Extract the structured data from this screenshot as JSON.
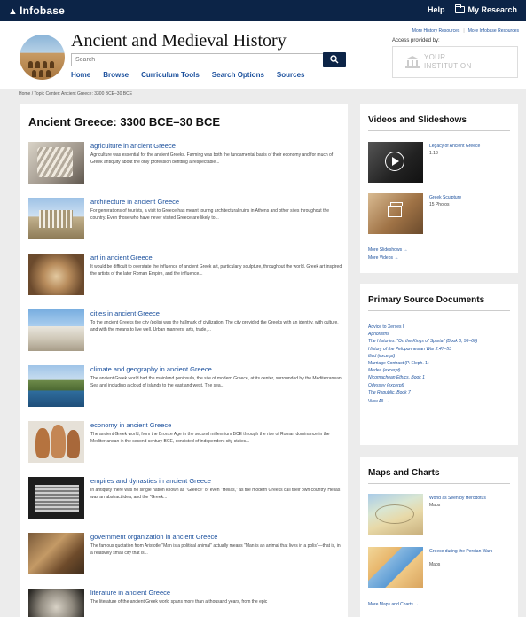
{
  "topbar": {
    "logo": "Infobase",
    "help": "Help",
    "my_research": "My Research"
  },
  "header": {
    "site_title": "Ancient and Medieval History",
    "search_placeholder": "Search",
    "nav": [
      "Home",
      "Browse",
      "Curriculum Tools",
      "Search Options",
      "Sources"
    ],
    "util_links": [
      "More History Resources",
      "More Infobase Resources"
    ],
    "access_label": "Access provided by:",
    "institution_line1": "YOUR",
    "institution_line2": "INSTITUTION"
  },
  "breadcrumb": "Home / Topic Center: Ancient Greece: 3300 BCE–30 BCE",
  "main": {
    "title": "Ancient Greece: 3300 BCE–30 BCE",
    "topics": [
      {
        "title": "agriculture in ancient Greece",
        "desc": "Agriculture was essential for the ancient Greeks. Farming was both the fundamental basis of their economy and for much of Greek antiquity about the only profession befitting a respectable..."
      },
      {
        "title": "architecture in ancient Greece",
        "desc": "For generations of tourists, a visit to Greece has meant touring architectural ruins in Athens and other sites throughout the country. Even those who have never visited Greece are likely to..."
      },
      {
        "title": "art in ancient Greece",
        "desc": "It would be difficult to overstate the influence of ancient Greek art, particularly sculpture, throughout the world. Greek art inspired the artists of the later Roman Empire, and the influence..."
      },
      {
        "title": "cities in ancient Greece",
        "desc": "To the ancient Greeks the city (polis) was the hallmark of civilization. The city provided the Greeks with an identity, with culture, and with the means to live well. Urban manners, arts, trade,..."
      },
      {
        "title": "climate and geography in ancient Greece",
        "desc": "The ancient Greek world had the mainland peninsula, the site of modern Greece, at its center, surrounded by the Mediterranean Sea and including a cloud of islands to the east and west. The sea..."
      },
      {
        "title": "economy in ancient Greece",
        "desc": "The ancient Greek world, from the Bronze Age in the second millennium BCE through the rise of Roman dominance in the Mediterranean in the second century BCE, consisted of independent city-states..."
      },
      {
        "title": "empires and dynasties in ancient Greece",
        "desc": "In antiquity there was no single nation known as \"Greece\" or even \"Hellas,\" as the modern Greeks call their own country. Hellas was an abstract idea, and the \"Greek..."
      },
      {
        "title": "government organization in ancient Greece",
        "desc": "The famous quotation from Aristotle \"Man is a political animal\" actually means \"Man is an animal that lives in a polis\"—that is, in a relatively small city that is..."
      },
      {
        "title": "literature in ancient Greece",
        "desc": "The literature of the ancient Greek world spans more than a thousand years, from the epic"
      }
    ]
  },
  "videos": {
    "heading": "Videos and Slideshows",
    "items": [
      {
        "title": "Legacy of Ancient Greece",
        "sub": "1:13"
      },
      {
        "title": "Greek Sculpture",
        "sub": "15 Photos"
      }
    ],
    "more_slideshows": "More Slideshows →",
    "more_videos": "More Videos →"
  },
  "documents": {
    "heading": "Primary Source Documents",
    "items": [
      {
        "text": "Advice to Xerxes I",
        "italic": false
      },
      {
        "text": "Aphorisms",
        "italic": true
      },
      {
        "text": "The Histories: \"On the Kings of Sparta\" (Book 6, 56–60)",
        "italic": true
      },
      {
        "text": "History of the Peloponnesian War 2.47–53",
        "italic": true
      },
      {
        "text": "Iliad (excerpt)",
        "italic": true
      },
      {
        "text": "Marriage Contract (P. Eleph. 1)",
        "italic": false
      },
      {
        "text": "Medea (excerpt)",
        "italic": true
      },
      {
        "text": "Nicomachean Ethics, Book 1",
        "italic": true
      },
      {
        "text": "Odyssey (excerpt)",
        "italic": true
      },
      {
        "text": "The Republic, Book 7",
        "italic": true
      }
    ],
    "view_all": "View All →"
  },
  "maps": {
    "heading": "Maps and Charts",
    "items": [
      {
        "title": "World as Seen by Herodotus",
        "sub": "Maps"
      },
      {
        "title": "Greece during the Persian Wars",
        "sub": "Maps"
      }
    ],
    "more": "More Maps and Charts →"
  },
  "colors": {
    "navy": "#0c2447",
    "link": "#1a4f9c",
    "background": "#ececec"
  }
}
